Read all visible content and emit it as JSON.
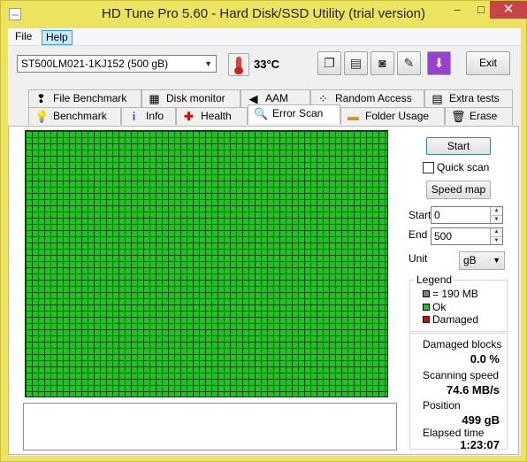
{
  "window": {
    "title": "HD Tune Pro 5.60 - Hard Disk/SSD Utility (trial version)",
    "minimize": "–",
    "maximize": "□",
    "close": "✕"
  },
  "menu": {
    "file": "File",
    "help": "Help"
  },
  "toolbar": {
    "drive": "ST500LM021-1KJ152 (500 gB)",
    "temperature": "33°C",
    "exit_label": "Exit",
    "buttons": [
      "copy-info-icon",
      "save-icon",
      "screenshot-camera-icon",
      "options-icon",
      "download-icon"
    ]
  },
  "tabs": {
    "top": [
      "File Benchmark",
      "Disk monitor",
      "AAM",
      "Random Access",
      "Extra tests"
    ],
    "bottom": [
      "Benchmark",
      "Info",
      "Health",
      "Error Scan",
      "Folder Usage",
      "Erase"
    ],
    "active": "Error Scan"
  },
  "scan": {
    "start_label": "Start",
    "quick_scan_label": "Quick scan",
    "quick_scan_checked": false,
    "speed_map_label": "Speed map",
    "start_field_label": "Start",
    "start_value": "0",
    "end_field_label": "End",
    "end_value": "500",
    "unit_label": "Unit",
    "unit_value": "gB"
  },
  "legend": {
    "title": "Legend",
    "block_size": "= 190 MB",
    "ok": "Ok",
    "damaged": "Damaged",
    "colors": {
      "block": "#808080",
      "ok": "#1fc51f",
      "damaged": "#e00000"
    }
  },
  "stats": {
    "damaged_blocks_label": "Damaged blocks",
    "damaged_blocks_value": "0.0 %",
    "scanning_speed_label": "Scanning speed",
    "scanning_speed_value": "74.6 MB/s",
    "position_label": "Position",
    "position_value": "499 gB",
    "elapsed_label": "Elapsed time",
    "elapsed_value": "1:23:07"
  }
}
